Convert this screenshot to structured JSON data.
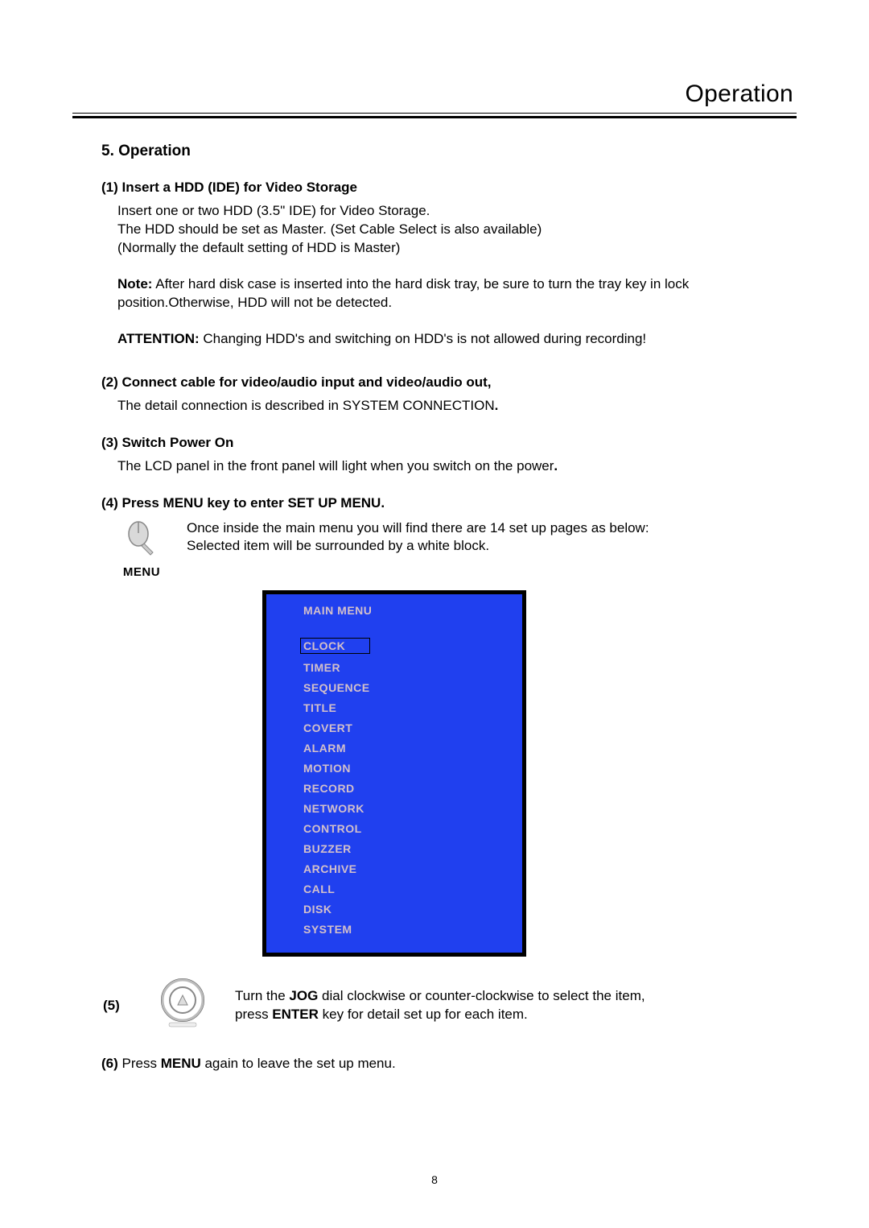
{
  "header": {
    "title": "Operation"
  },
  "section": {
    "heading": "5. Operation"
  },
  "step1": {
    "head": "(1)  Insert a HDD (IDE) for Video Storage",
    "line1": "Insert one or two HDD (3.5\" IDE) for Video Storage.",
    "line2": "The HDD should be set as Master. (Set Cable Select is also available)",
    "line3": "(Normally the default setting of HDD is Master)",
    "note_label": "Note:",
    "note_text": " After hard disk case is inserted into the hard disk tray, be sure to turn the tray key in lock position.Otherwise, HDD will not be detected.",
    "attn_label": "ATTENTION:",
    "attn_text": " Changing HDD's and switching on HDD's is not allowed during recording!"
  },
  "step2": {
    "head": "(2)  Connect cable for video/audio input and video/audio out,",
    "line1_a": "The detail connection is described in SYSTEM CONNECTION",
    "line1_b": "."
  },
  "step3": {
    "head": "(3)  Switch Power On",
    "line1_a": "The LCD panel in the front panel will light when you switch on the power",
    "line1_b": "."
  },
  "step4": {
    "head": "(4)  Press MENU key to enter SET UP MENU.",
    "desc1": "Once inside the main menu you will find there are 14 set up pages as  below:",
    "desc2": "Selected item will be surrounded by a white block.",
    "icon_label": "MENU"
  },
  "menu": {
    "title": "MAIN MENU",
    "items": [
      "CLOCK",
      "TIMER",
      "SEQUENCE",
      "TITLE",
      "COVERT",
      "ALARM",
      "MOTION",
      "RECORD",
      "NETWORK",
      "CONTROL",
      "BUZZER",
      "ARCHIVE",
      "CALL",
      "DISK",
      "SYSTEM"
    ],
    "selected_index": 0
  },
  "step5": {
    "num": "(5)",
    "t1": "Turn the ",
    "jog": "JOG",
    "t2": " dial clockwise or counter-clockwise to select the item,",
    "t3": "press ",
    "enter": "ENTER",
    "t4": "  key for detail set up for each item."
  },
  "step6": {
    "num": "(6) ",
    "t1": "Press ",
    "menu": "MENU",
    "t2": " again to leave the set up menu."
  },
  "page_number": "8"
}
